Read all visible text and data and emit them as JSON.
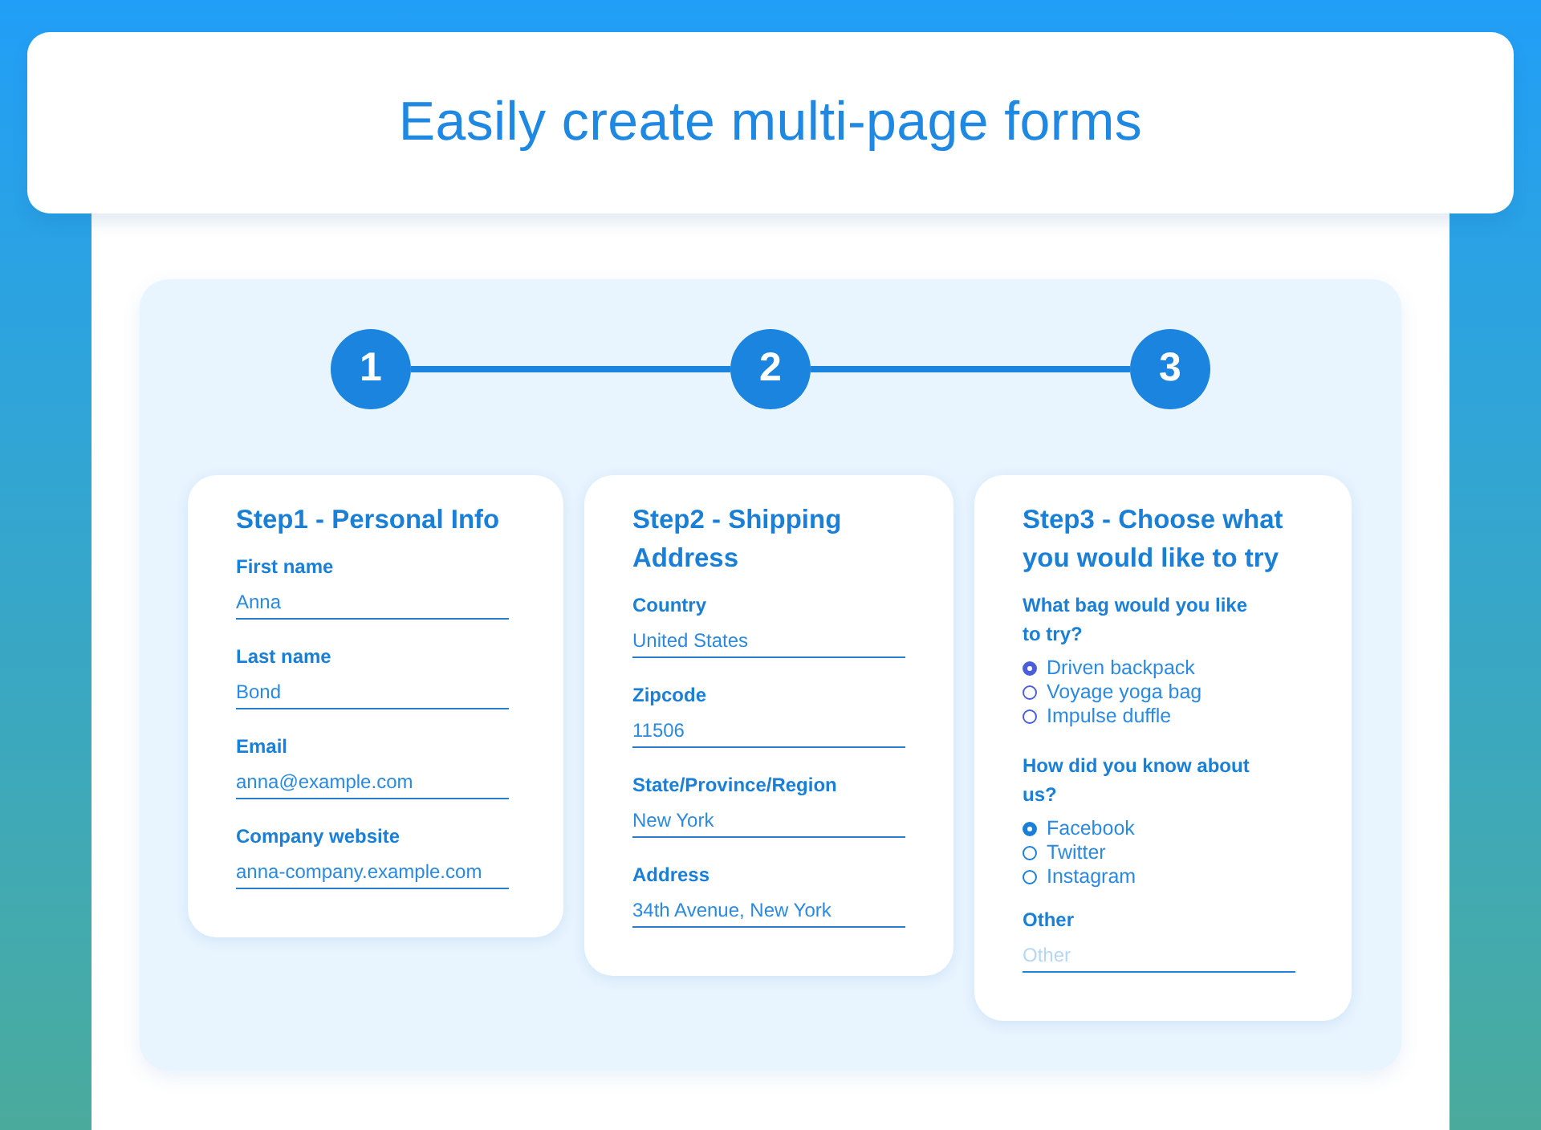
{
  "banner": {
    "title": "Easily create multi-page forms"
  },
  "stepper": {
    "steps": [
      {
        "label": "1"
      },
      {
        "label": "2"
      },
      {
        "label": "3"
      }
    ]
  },
  "cards": [
    {
      "title": "Step1 - Personal Info",
      "items": [
        {
          "kind": "text",
          "label": "First name",
          "value": "Anna"
        },
        {
          "kind": "text",
          "label": "Last name",
          "value": "Bond"
        },
        {
          "kind": "text",
          "label": "Email",
          "value": "anna@example.com"
        },
        {
          "kind": "text",
          "label": "Company website",
          "value": "anna-company.example.com"
        }
      ]
    },
    {
      "title": "Step2 - Shipping Address",
      "items": [
        {
          "kind": "text",
          "label": "Country",
          "value": "United States"
        },
        {
          "kind": "text",
          "label": "Zipcode",
          "value": "11506"
        },
        {
          "kind": "text",
          "label": "State/Province/Region",
          "value": "New York"
        },
        {
          "kind": "text",
          "label": "Address",
          "value": "34th Avenue, New York"
        }
      ]
    },
    {
      "title": "Step3 - Choose what you would like to try",
      "items": [
        {
          "kind": "radio",
          "label": "What bag would you like to try?",
          "color": "#4a5fd8",
          "options": [
            {
              "label": "Driven backpack",
              "selected": true
            },
            {
              "label": "Voyage yoga bag",
              "selected": false
            },
            {
              "label": "Impulse duffle",
              "selected": false
            }
          ]
        },
        {
          "kind": "radio",
          "label": "How did you know about us?",
          "color": "#1a7fd6",
          "options": [
            {
              "label": "Facebook",
              "selected": true
            },
            {
              "label": "Twitter",
              "selected": false
            },
            {
              "label": "Instagram",
              "selected": false
            }
          ]
        },
        {
          "kind": "text",
          "label": "Other",
          "placeholder": "Other"
        }
      ]
    }
  ]
}
